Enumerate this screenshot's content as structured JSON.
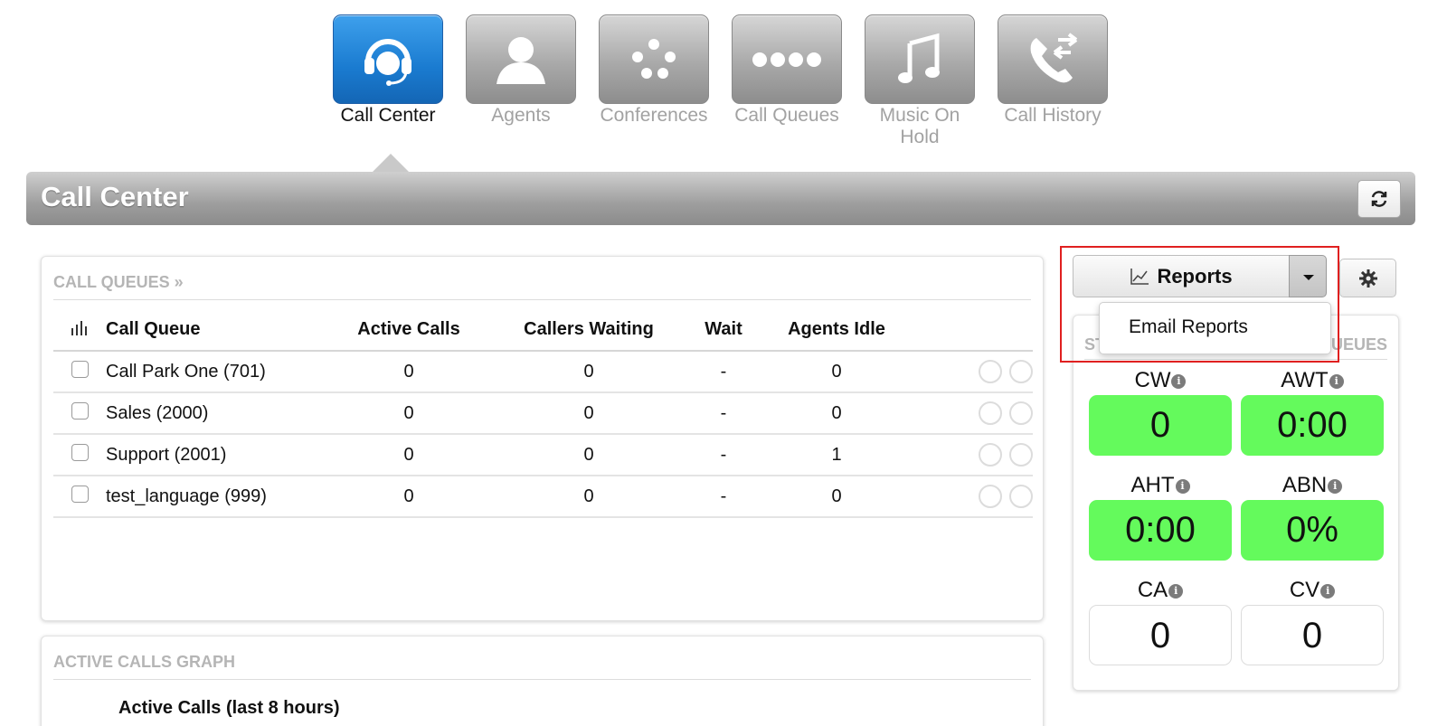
{
  "nav": {
    "items": [
      {
        "label": "Call Center",
        "icon": "headset-icon",
        "active": true
      },
      {
        "label": "Agents",
        "icon": "user-icon",
        "active": false
      },
      {
        "label": "Conferences",
        "icon": "conference-dots-icon",
        "active": false
      },
      {
        "label": "Call Queues",
        "icon": "queue-dots-icon",
        "active": false
      },
      {
        "label": "Music On Hold",
        "icon": "music-note-icon",
        "active": false
      },
      {
        "label": "Call History",
        "icon": "call-history-icon",
        "active": false
      }
    ]
  },
  "page": {
    "title": "Call Center"
  },
  "queues_panel": {
    "title": "CALL QUEUES »",
    "columns": [
      "Call Queue",
      "Active Calls",
      "Callers Waiting",
      "Wait",
      "Agents Idle"
    ],
    "rows": [
      {
        "name": "Call Park One (701)",
        "active_calls": "0",
        "callers_waiting": "0",
        "wait": "-",
        "agents_idle": "0"
      },
      {
        "name": "Sales (2000)",
        "active_calls": "0",
        "callers_waiting": "0",
        "wait": "-",
        "agents_idle": "0"
      },
      {
        "name": "Support (2001)",
        "active_calls": "0",
        "callers_waiting": "0",
        "wait": "-",
        "agents_idle": "1"
      },
      {
        "name": "test_language (999)",
        "active_calls": "0",
        "callers_waiting": "0",
        "wait": "-",
        "agents_idle": "0"
      }
    ]
  },
  "graph_panel": {
    "title": "ACTIVE CALLS GRAPH",
    "subtitle": "Active Calls (last 8 hours)"
  },
  "toolbar": {
    "reports_label": "Reports",
    "dropdown_item": "Email Reports"
  },
  "stats_panel": {
    "title_left": "ST",
    "title_right": "UEUES",
    "cards": [
      {
        "label": "CW",
        "value": "0",
        "highlight": true
      },
      {
        "label": "AWT",
        "value": "0:00",
        "highlight": true
      },
      {
        "label": "AHT",
        "value": "0:00",
        "highlight": true
      },
      {
        "label": "ABN",
        "value": "0%",
        "highlight": true
      },
      {
        "label": "CA",
        "value": "0",
        "highlight": false
      },
      {
        "label": "CV",
        "value": "0",
        "highlight": false
      }
    ]
  },
  "colors": {
    "accent_blue": "#1a7bd0",
    "link_blue": "#1f7fd4",
    "stat_green": "#64fa5c",
    "highlight_red": "#e02020"
  }
}
